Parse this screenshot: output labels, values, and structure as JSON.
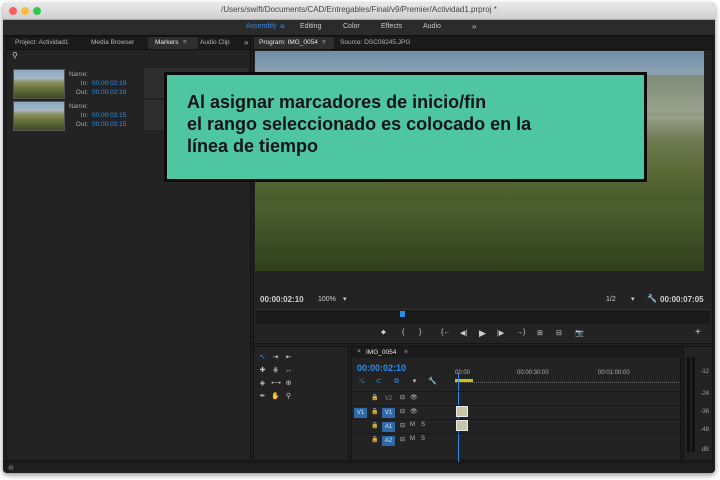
{
  "window": {
    "title": "/Users/swift/Documents/CAD/Entregables/Final/v9/Premier/Actividad1.prproj *"
  },
  "workspaces": [
    "Assembly",
    "Editing",
    "Color",
    "Effects",
    "Audio"
  ],
  "workspace_active": "Assembly",
  "left_panel": {
    "tabs": [
      "Project: Actividad1",
      "Media Browser",
      "Markers",
      "Audio Clip"
    ],
    "active_tab": "Markers",
    "markers": [
      {
        "name_label": "Name:",
        "in_label": "In:",
        "in": "00:00:02:19",
        "out_label": "Out:",
        "out": "00:00:02:19"
      },
      {
        "name_label": "Name:",
        "in_label": "In:",
        "in": "00:00:03:15",
        "out_label": "Out:",
        "out": "00:00:03:15"
      }
    ]
  },
  "program_monitor": {
    "tabs": [
      "Program: IMG_0054",
      "Source: DSC08245.JPG"
    ],
    "active_tab": "Program: IMG_0054",
    "timecode": "00:00:02:10",
    "zoom": "100%",
    "resolution": "1/2",
    "duration": "00:00:07:05"
  },
  "overlay": {
    "lines": [
      "Al asignar marcadores de inicio/fin",
      "el rango seleccionado es colocado en la",
      "línea de tiempo"
    ],
    "bg_color": "#4fc6a2"
  },
  "timeline": {
    "sequence": "IMG_0054",
    "timecode": "00:00:02:10",
    "ruler": [
      "00:00",
      "00:00:30:00",
      "00:01:00:00"
    ],
    "tracks": [
      {
        "source": "",
        "name": "V2"
      },
      {
        "source": "V1",
        "name": "V1"
      },
      {
        "source": "",
        "name": "A1",
        "m": "M",
        "s": "S"
      },
      {
        "source": "",
        "name": "A2",
        "m": "M",
        "s": "S"
      }
    ]
  },
  "audio_meter": {
    "labels": [
      "-12",
      "-24",
      "-36",
      "-48",
      "dB"
    ]
  }
}
